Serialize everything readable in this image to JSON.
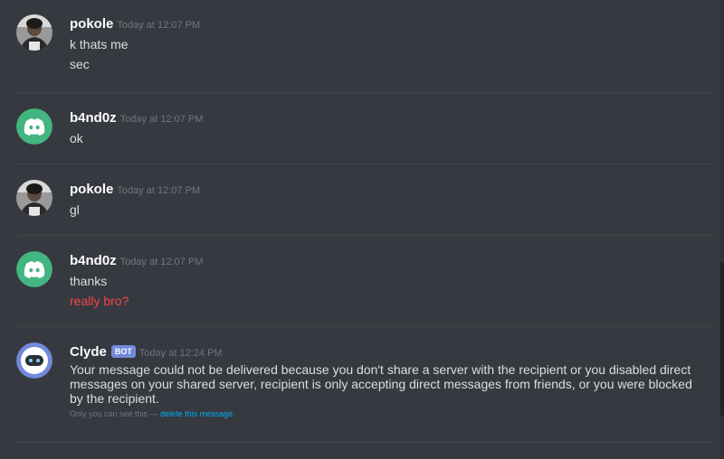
{
  "messages": [
    {
      "username": "pokole",
      "timestamp": "Today at 12:07 PM",
      "avatar_icon": "user-photo-avatar",
      "lines": [
        "k thats me",
        "sec"
      ]
    },
    {
      "username": "b4nd0z",
      "timestamp": "Today at 12:07 PM",
      "avatar_icon": "discord-logo-avatar",
      "avatar_color": "#43b581",
      "lines": [
        "ok"
      ]
    },
    {
      "username": "pokole",
      "timestamp": "Today at 12:07 PM",
      "avatar_icon": "user-photo-avatar",
      "lines": [
        "gl"
      ]
    },
    {
      "username": "b4nd0z",
      "timestamp": "Today at 12:07 PM",
      "avatar_icon": "discord-logo-avatar",
      "avatar_color": "#43b581",
      "lines": [
        "thanks"
      ],
      "failed_line": "really bro?",
      "failed_color": "#f04747"
    },
    {
      "username": "Clyde",
      "badge": "BOT",
      "timestamp": "Today at 12:24 PM",
      "avatar_icon": "clyde-bot-avatar",
      "avatar_color": "#7289da",
      "text": "Your message could not be delivered because you don't share a server with the recipient or you disabled direct messages on your shared server, recipient is only accepting direct messages from friends, or you were blocked by the recipient.",
      "ephemeral_note": "Only you can see this —",
      "delete_link": "delete this message."
    }
  ],
  "colors": {
    "background": "#36393f",
    "divider": "#40444b",
    "username": "#ffffff",
    "text": "#dcddde",
    "timestamp": "#72767d",
    "link": "#00b0f4",
    "bot_badge": "#7289da"
  }
}
